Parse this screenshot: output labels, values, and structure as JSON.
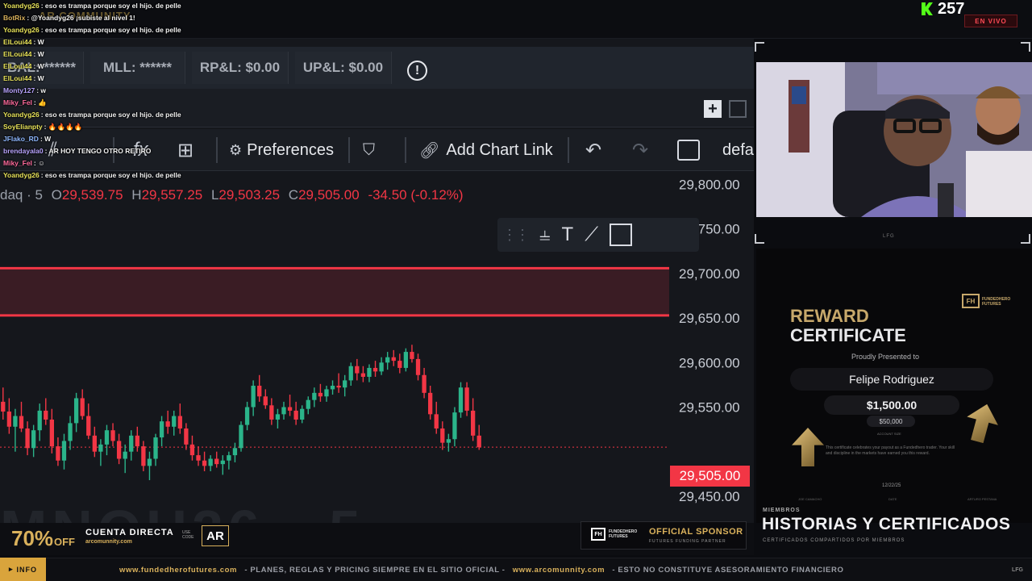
{
  "stream": {
    "viewer_count": "257",
    "live_label": "EN VIVO",
    "community_logo": "AR COMMUNITY"
  },
  "account_stats": {
    "bal": "BAL: ******",
    "mll": "MLL: ******",
    "rpl": "RP&L: $0.00",
    "upl": "UP&L: $0.00"
  },
  "toolbar": {
    "preferences": "Preferences",
    "add_chart_link": "Add Chart Link",
    "layout_label": "defa"
  },
  "chart": {
    "symbol_label": "daq · 5",
    "ohlc": {
      "o": "29,539.75",
      "h": "29,557.25",
      "l": "29,503.25",
      "c": "29,505.00",
      "change": "-34.50 (-0.12%)"
    },
    "current_price": "29,505.00",
    "watermark": "MNQU26 · 5"
  },
  "chart_data": {
    "type": "candlestick",
    "y_ticks": [
      "29,800.00",
      "29,750.00",
      "29,700.00",
      "29,650.00",
      "29,600.00",
      "29,550.00",
      "29,450.00"
    ],
    "ylim": [
      29420,
      29815
    ],
    "zone": [
      29653,
      29706
    ],
    "last_price": 29505.0,
    "candles": [
      [
        29556,
        29572,
        29536,
        29545
      ],
      [
        29545,
        29560,
        29520,
        29528
      ],
      [
        29528,
        29548,
        29500,
        29540
      ],
      [
        29540,
        29556,
        29522,
        29526
      ],
      [
        29526,
        29534,
        29496,
        29504
      ],
      [
        29504,
        29530,
        29494,
        29524
      ],
      [
        29524,
        29554,
        29512,
        29546
      ],
      [
        29546,
        29560,
        29530,
        29536
      ],
      [
        29536,
        29548,
        29498,
        29506
      ],
      [
        29506,
        29516,
        29484,
        29490
      ],
      [
        29490,
        29520,
        29480,
        29512
      ],
      [
        29512,
        29540,
        29502,
        29532
      ],
      [
        29532,
        29566,
        29522,
        29560
      ],
      [
        29560,
        29570,
        29536,
        29540
      ],
      [
        29540,
        29554,
        29514,
        29518
      ],
      [
        29518,
        29528,
        29494,
        29500
      ],
      [
        29500,
        29514,
        29484,
        29508
      ],
      [
        29508,
        29530,
        29496,
        29524
      ],
      [
        29524,
        29532,
        29506,
        29512
      ],
      [
        29512,
        29520,
        29486,
        29492
      ],
      [
        29492,
        29508,
        29476,
        29500
      ],
      [
        29500,
        29524,
        29490,
        29518
      ],
      [
        29518,
        29528,
        29500,
        29506
      ],
      [
        29506,
        29512,
        29478,
        29484
      ],
      [
        29484,
        29500,
        29468,
        29492
      ],
      [
        29492,
        29520,
        29484,
        29516
      ],
      [
        29516,
        29540,
        29506,
        29534
      ],
      [
        29534,
        29546,
        29520,
        29528
      ],
      [
        29528,
        29546,
        29518,
        29540
      ],
      [
        29540,
        29554,
        29520,
        29526
      ],
      [
        29526,
        29532,
        29502,
        29508
      ],
      [
        29508,
        29518,
        29490,
        29496
      ],
      [
        29496,
        29506,
        29484,
        29490
      ],
      [
        29490,
        29500,
        29478,
        29484
      ],
      [
        29484,
        29496,
        29478,
        29492
      ],
      [
        29492,
        29500,
        29482,
        29486
      ],
      [
        29486,
        29496,
        29474,
        29490
      ],
      [
        29490,
        29500,
        29480,
        29496
      ],
      [
        29496,
        29510,
        29488,
        29504
      ],
      [
        29504,
        29534,
        29500,
        29530
      ],
      [
        29530,
        29556,
        29524,
        29550
      ],
      [
        29550,
        29580,
        29540,
        29574
      ],
      [
        29574,
        29586,
        29556,
        29562
      ],
      [
        29562,
        29570,
        29548,
        29552
      ],
      [
        29552,
        29560,
        29530,
        29536
      ],
      [
        29536,
        29548,
        29526,
        29542
      ],
      [
        29542,
        29556,
        29536,
        29550
      ],
      [
        29550,
        29564,
        29540,
        29546
      ],
      [
        29546,
        29556,
        29530,
        29536
      ],
      [
        29536,
        29552,
        29532,
        29548
      ],
      [
        29548,
        29562,
        29542,
        29558
      ],
      [
        29558,
        29572,
        29550,
        29566
      ],
      [
        29566,
        29576,
        29556,
        29562
      ],
      [
        29562,
        29574,
        29556,
        29570
      ],
      [
        29570,
        29580,
        29564,
        29574
      ],
      [
        29574,
        29588,
        29566,
        29572
      ],
      [
        29572,
        29586,
        29562,
        29580
      ],
      [
        29580,
        29600,
        29574,
        29596
      ],
      [
        29596,
        29604,
        29580,
        29588
      ],
      [
        29588,
        29596,
        29578,
        29584
      ],
      [
        29584,
        29598,
        29578,
        29594
      ],
      [
        29594,
        29602,
        29584,
        29590
      ],
      [
        29590,
        29606,
        29586,
        29600
      ],
      [
        29600,
        29612,
        29592,
        29606
      ],
      [
        29606,
        29614,
        29596,
        29602
      ],
      [
        29602,
        29610,
        29588,
        29594
      ],
      [
        29594,
        29616,
        29590,
        29612
      ],
      [
        29612,
        29620,
        29600,
        29604
      ],
      [
        29604,
        29610,
        29580,
        29586
      ],
      [
        29586,
        29594,
        29560,
        29566
      ],
      [
        29566,
        29574,
        29536,
        29542
      ],
      [
        29542,
        29556,
        29520,
        29526
      ],
      [
        29526,
        29534,
        29502,
        29510
      ],
      [
        29510,
        29520,
        29500,
        29514
      ],
      [
        29514,
        29550,
        29506,
        29544
      ],
      [
        29544,
        29578,
        29538,
        29572
      ],
      [
        29572,
        29578,
        29540,
        29546
      ],
      [
        29546,
        29560,
        29512,
        29518
      ],
      [
        29518,
        29530,
        29502,
        29505
      ]
    ]
  },
  "chat": [
    {
      "user": "Yoandyg26",
      "color": "#e8e35a",
      "msg": "eso es trampa porque soy el hijo. de pelle"
    },
    {
      "user": "BotRix",
      "color": "#d9b15c",
      "msg": "@Yoandyg26 ¡subiste al nivel 1!"
    },
    {
      "user": "Yoandyg26",
      "color": "#e8e35a",
      "msg": "eso es trampa porque soy el hijo. de pelle"
    },
    {
      "user": "ElLoui44",
      "color": "#e8e35a",
      "msg": "W"
    },
    {
      "user": "ElLoui44",
      "color": "#e8e35a",
      "msg": "W"
    },
    {
      "user": "ElLoui44",
      "color": "#e8e35a",
      "msg": "W"
    },
    {
      "user": "ElLoui44",
      "color": "#e8e35a",
      "msg": "W"
    },
    {
      "user": "Monty127",
      "color": "#b9a4ff",
      "msg": "w"
    },
    {
      "user": "Miky_Fel",
      "color": "#ff6b9d",
      "msg": "👍"
    },
    {
      "user": "Yoandyg26",
      "color": "#e8e35a",
      "msg": "eso es trampa porque soy el hijo. de pelle"
    },
    {
      "user": "SoyElianpty",
      "color": "#e8e35a",
      "msg": "🔥🔥🔥🔥"
    },
    {
      "user": "JFlako_RD",
      "color": "#8fb8ff",
      "msg": "W"
    },
    {
      "user": "brendayala0",
      "color": "#b9a4ff",
      "msg": "AR HOY TENGO OTRO RETIRO"
    },
    {
      "user": "Miky_Fel",
      "color": "#ff6b9d",
      "msg": "☺"
    },
    {
      "user": "Yoandyg26",
      "color": "#e8e35a",
      "msg": "eso es trampa porque soy el hijo. de pelle"
    }
  ],
  "certificate": {
    "reward": "REWARD",
    "certificate": "CERTIFICATE",
    "presented": "Proudly Presented to",
    "name": "Felipe Rodriguez",
    "amount": "$1,500.00",
    "account_size": "$50,000",
    "account_size_label": "ACCOUNT SIZE",
    "body": "This certificate celebrates your payout as a Fundedhero trader. Your skill and discipline in the markets have earned you this reward.",
    "date": "12/22/25",
    "date_label": "DATE",
    "signer_left": "JOE CAMACHO",
    "signer_right": "ARTURO PESTANA",
    "brand_line1": "FUNDEDHERO",
    "brand_line2": "FUTURES"
  },
  "members": {
    "label": "MIEMBROS",
    "title": "HISTORIAS Y CERTIFICADOS",
    "subtitle": "CERTIFICADOS COMPARTIDOS POR MIEMBROS"
  },
  "promo": {
    "percent": "70%",
    "off": "OFF",
    "cuenta": "CUENTA DIRECTA",
    "url": "arcomunnity.com",
    "use_code": "USE CODE",
    "code": "AR",
    "sponsor_title": "OFFICIAL SPONSOR",
    "sponsor_sub": "FUTURES FUNDING PARTNER",
    "sponsor_brand1": "FUNDEDHERO",
    "sponsor_brand2": "FUTURES"
  },
  "ticker": {
    "info": "INFO",
    "url1": "www.fundedherofutures.com",
    "text1": "- PLANES, REGLAS Y PRICING SIEMPRE EN EL SITIO OFICIAL -",
    "url2": "www.arcomunnity.com",
    "text2": "- ESTO NO CONSTITUYE ASESORAMIENTO FINANCIERO",
    "lfg": "LFG"
  },
  "colors": {
    "bull": "#2bb48a",
    "bear": "#f23645",
    "gold": "#d9b15c"
  }
}
